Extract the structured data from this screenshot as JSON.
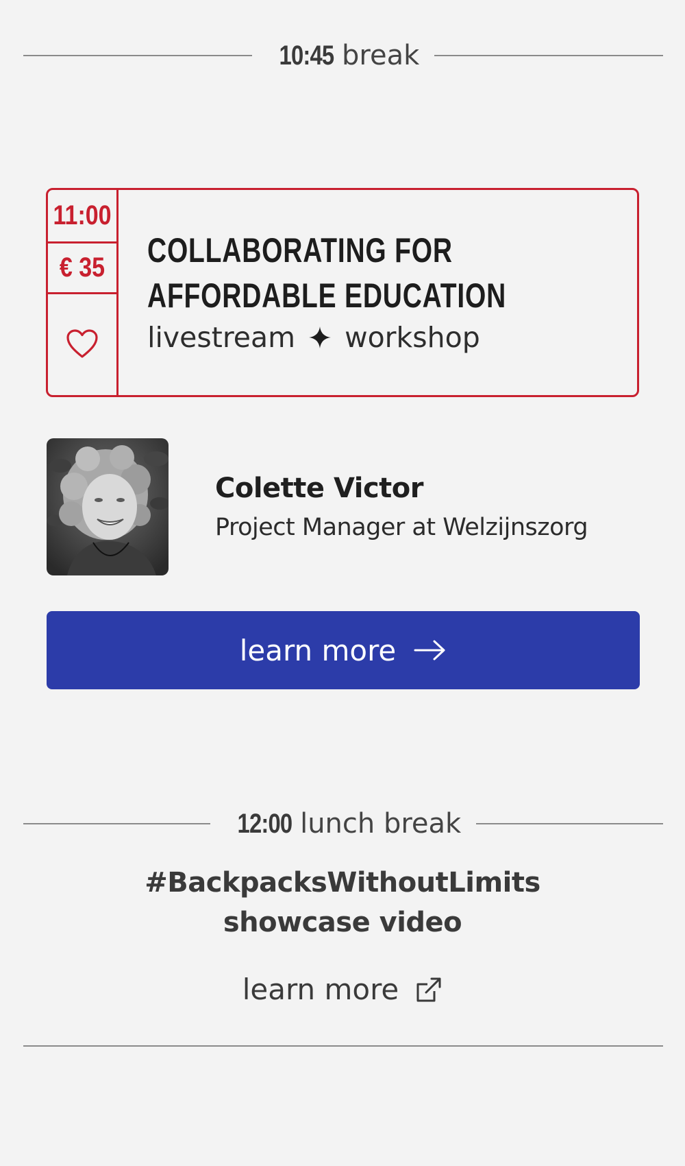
{
  "colors": {
    "background": "#f3f3f3",
    "accent_red": "#c8202f",
    "button_blue": "#2c3ca9",
    "divider": "#8a8a8a"
  },
  "breaks": [
    {
      "time": "10:45",
      "label": "break"
    },
    {
      "time": "12:00",
      "label": "lunch break"
    }
  ],
  "session": {
    "time": "11:00",
    "price": "€ 35",
    "favorite_icon": "heart-icon",
    "title_line1": "Collaborating for",
    "title_line2": "affordable education",
    "tag1": "livestream",
    "tag_separator_icon": "four-point-star-icon",
    "tag2": "workshop"
  },
  "speaker": {
    "name": "Colette Victor",
    "role": "Project Manager at Welzijnszorg",
    "photo_icon": "speaker-photo"
  },
  "primary_button": {
    "label": "learn more",
    "icon": "arrow-right-icon"
  },
  "lunch_promo": {
    "title_line1": "#BackpacksWithoutLimits",
    "title_line2": "showcase video",
    "link_label": "learn more",
    "link_icon": "external-link-icon"
  }
}
